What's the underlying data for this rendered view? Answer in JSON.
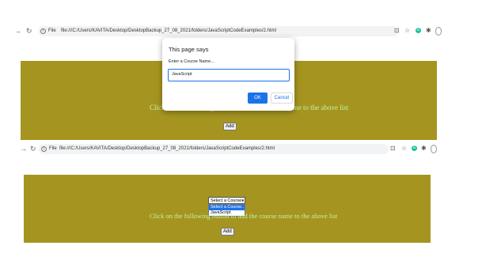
{
  "top": {
    "url": "file:///C:/Users/KAVITA/Desktop/DesktopBackup_27_08_2021/folders/JavaScriptCodeExamples/2.html",
    "file_label": "File",
    "hint": "Click on the following button to add the course name to the above list",
    "add_label": "Add"
  },
  "dialog": {
    "title": "This page says",
    "message": "Enter a Course Name...",
    "input_value": "JavaScript",
    "ok_label": "OK",
    "cancel_label": "Cancel"
  },
  "bottom": {
    "url": "file:///C:/Users/KAVITA/Desktop/DesktopBackup_27_08_2021/folders/JavaScriptCodeExamples/2.html",
    "file_label": "File",
    "select_value": "Select a Course..",
    "options": [
      "Select a Course..",
      "JavaScript"
    ],
    "hint": "Click on the following button to add the course name to the above list",
    "add_label": "Add"
  },
  "colors": {
    "content_bg": "#a59520",
    "hint_text": "#c6f0a2",
    "accent": "#1a73e8"
  },
  "icons": [
    "back-arrow-icon",
    "reload-icon",
    "info-icon",
    "install-icon",
    "star-icon",
    "grammarly-icon",
    "extensions-icon",
    "profile-icon"
  ]
}
